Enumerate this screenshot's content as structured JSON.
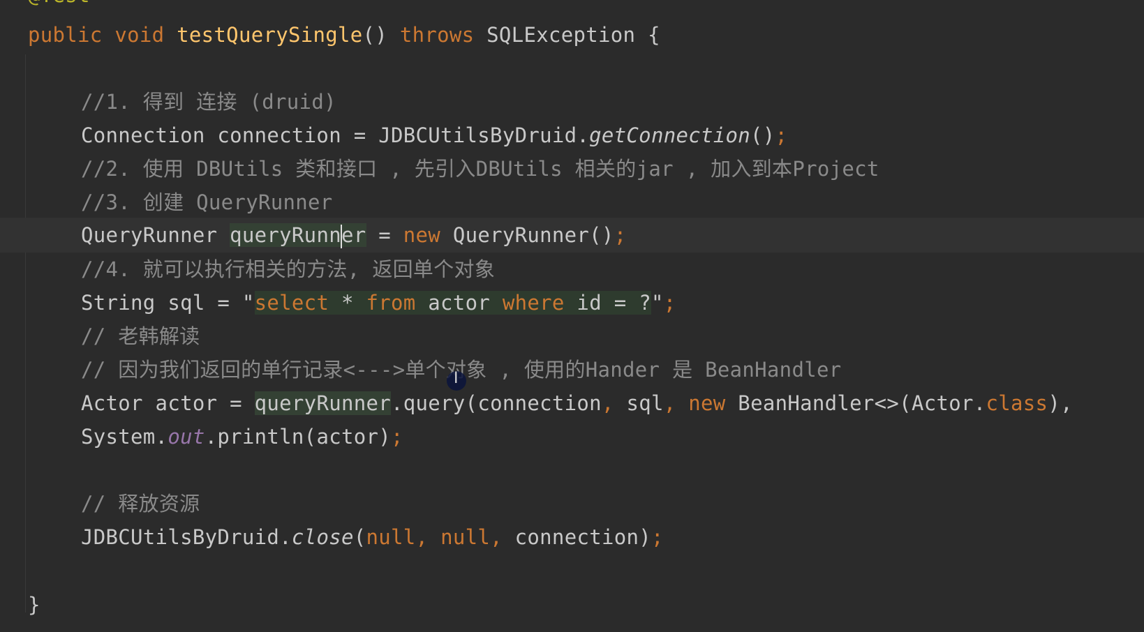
{
  "editor": {
    "annotation": "@Test",
    "signature": {
      "mod1": "public",
      "mod2": "void",
      "method": "testQuerySingle",
      "parens": "()",
      "throws": "throws",
      "exception": "SQLException",
      "brace": "{"
    },
    "comment1": "//1. 得到 连接 (druid)",
    "conn_line": {
      "type": "Connection connection = JDBCUtilsByDruid.",
      "call": "getConnection",
      "end": "()",
      "semi": ";"
    },
    "comment2": "//2. 使用 DBUtils 类和接口 , 先引入DBUtils 相关的jar , 加入到本Project",
    "comment3": "//3. 创建 QueryRunner",
    "runner_line": {
      "type": "QueryRunner ",
      "var_a": "queryRunn",
      "var_b": "er",
      "assign": " = ",
      "new": "new",
      "ctor": " QueryRunner()",
      "semi": ";"
    },
    "comment4": "//4. 就可以执行相关的方法, 返回单个对象",
    "sql_line": {
      "decl": "String sql = \"",
      "select": "select",
      "star": " * ",
      "from": "from",
      "actor": " actor ",
      "where": "where",
      "rest": " id = ?",
      "quote": "\"",
      "semi": ";"
    },
    "comment5": "// 老韩解读",
    "comment6": "// 因为我们返回的单行记录<--->单个对象 , 使用的Hander 是 BeanHandler",
    "actor_line": {
      "decl": "Actor actor = ",
      "runner": "queryRunner",
      "call": ".query(connection",
      "c1": ",",
      "sql": " sql",
      "c2": ",",
      "new": " new",
      "handler": " BeanHandler<>(Actor.",
      "class": "class",
      "end": "),"
    },
    "print_line": {
      "sys": "System.",
      "out": "out",
      "rest": ".println(actor)",
      "semi": ";"
    },
    "comment7": "// 释放资源",
    "close_line": {
      "cls": "JDBCUtilsByDruid.",
      "call": "close",
      "open": "(",
      "null1": "null",
      "c1": ", ",
      "null2": "null",
      "c2": ", ",
      "rest": "connection)",
      "semi": ";"
    },
    "closing_brace": "}"
  }
}
